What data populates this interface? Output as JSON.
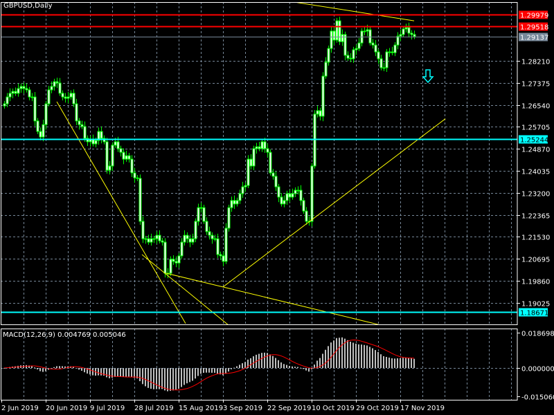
{
  "header": {
    "title": "GBPUSD,Daily"
  },
  "colors": {
    "background": "#000000",
    "grid": "#778899",
    "candle": "#00ff00",
    "body": "#ffffff",
    "resistance": "#ff0000",
    "support": "#00ffff",
    "bid": "#778899",
    "trendline": "#ffff00",
    "macd_hist": "#c0c0c0",
    "macd_signal": "#ff0000",
    "axis": "#ffffff"
  },
  "chart_data": {
    "type": "candlestick",
    "symbol": "GBPUSD",
    "timeframe": "Daily",
    "first_open": 1.265,
    "closes": [
      1.2658,
      1.2684,
      1.2698,
      1.2705,
      1.2698,
      1.2716,
      1.2724,
      1.2716,
      1.2711,
      1.2684,
      1.2684,
      1.2593,
      1.2553,
      1.2532,
      1.2579,
      1.2658,
      1.2711,
      1.2724,
      1.2742,
      1.2737,
      1.2698,
      1.2684,
      1.2679,
      1.2684,
      1.2698,
      1.2658,
      1.2593,
      1.2579,
      1.2572,
      1.2527,
      1.2514,
      1.2522,
      1.2506,
      1.2519,
      1.2553,
      1.2527,
      1.2514,
      1.2406,
      1.2422,
      1.2501,
      1.2514,
      1.2488,
      1.2474,
      1.2448,
      1.2461,
      1.2448,
      1.2396,
      1.2377,
      1.2375,
      1.2212,
      1.2146,
      1.2146,
      1.2133,
      1.2146,
      1.2146,
      1.2159,
      1.2138,
      1.2133,
      1.2015,
      1.2015,
      1.2068,
      1.206,
      1.2054,
      1.2081,
      1.2133,
      1.2159,
      1.2146,
      1.2133,
      1.2146,
      1.2212,
      1.2264,
      1.2264,
      1.2212,
      1.2173,
      1.2159,
      1.2146,
      1.2146,
      1.2086,
      1.2081,
      1.206,
      1.2186,
      1.2264,
      1.2291,
      1.2278,
      1.2291,
      1.2317,
      1.2343,
      1.2348,
      1.2448,
      1.2422,
      1.2488,
      1.2495,
      1.2488,
      1.2514,
      1.2488,
      1.2474,
      1.2396,
      1.2383,
      1.2343,
      1.2304,
      1.2278,
      1.2291,
      1.2317,
      1.2304,
      1.2317,
      1.233,
      1.233,
      1.2291,
      1.2251,
      1.2212,
      1.2212,
      1.2422,
      1.2619,
      1.2632,
      1.2611,
      1.2763,
      1.2816,
      1.2868,
      1.2934,
      1.29,
      1.2973,
      1.2894,
      1.2921,
      1.2842,
      1.2831,
      1.2829,
      1.2863,
      1.2868,
      1.2889,
      1.2934,
      1.2934,
      1.2939,
      1.2889,
      1.2881,
      1.2855,
      1.2829,
      1.2795,
      1.2795,
      1.2855,
      1.2855,
      1.2852,
      1.2881,
      1.2915,
      1.2921,
      1.2942,
      1.2947,
      1.2926,
      1.2921,
      1.29137
    ],
    "y_ticks": [
      "1.28210",
      "1.27375",
      "1.26540",
      "1.25705",
      "1.24870",
      "1.24035",
      "1.23200",
      "1.22365",
      "1.21530",
      "1.20695",
      "1.19860",
      "1.19025"
    ],
    "y_tick_values": [
      1.2821,
      1.27375,
      1.2654,
      1.25705,
      1.2487,
      1.24035,
      1.232,
      1.22365,
      1.2153,
      1.20695,
      1.1986,
      1.19025
    ],
    "x_ticks": [
      "2 Jun 2019",
      "20 Jun 2019",
      "9 Jul 2019",
      "28 Jul 2019",
      "15 Aug 2019",
      "3 Sep 2019",
      "22 Sep 2019",
      "10 Oct 2019",
      "29 Oct 2019",
      "17 Nov 2019"
    ],
    "x_tick_bar_step": 16,
    "horizontal_lines": [
      {
        "name": "resistance-line-1",
        "price": 1.29979,
        "label": "1.29979",
        "color": "#ff0000"
      },
      {
        "name": "resistance-line-2",
        "price": 1.29518,
        "label": "1.29518",
        "color": "#ff0000"
      },
      {
        "name": "bid-line",
        "price": 1.29137,
        "label": "1.29137",
        "color": "#778899"
      },
      {
        "name": "support-line-1",
        "price": 1.25244,
        "label": "1.25244",
        "color": "#00ffff"
      },
      {
        "name": "support-line-2",
        "price": 1.18671,
        "label": "1.18671",
        "color": "#00ffff"
      }
    ],
    "trendlines": [
      {
        "from": [
          19,
          1.2666
        ],
        "to": [
          65.5,
          1.1824
        ]
      },
      {
        "from": [
          49.75,
          1.2086
        ],
        "to": [
          81,
          1.1818
        ]
      },
      {
        "from": [
          58.5,
          1.2015
        ],
        "to": [
          136,
          1.1818
        ]
      },
      {
        "from": [
          79,
          1.1963
        ],
        "to": [
          159.25,
          1.2601
        ]
      },
      {
        "from": [
          104.75,
          1.3044
        ],
        "to": [
          148,
          1.2973
        ]
      }
    ],
    "sell_arrow": {
      "bar": 153,
      "price": 1.2758
    },
    "macd": {
      "label": "MACD(12,26,9) 0.004769 0.005046",
      "fast": 12,
      "slow": 26,
      "signal": 9,
      "main": 0.004769,
      "signal_value": 0.005046,
      "ylim": [
        -0.01506,
        0.018698
      ],
      "y_ticks": [
        "0.018698",
        "0.000000",
        "-0.015060"
      ],
      "y_tick_values": [
        0.018698,
        0.0,
        -0.01506
      ]
    }
  }
}
